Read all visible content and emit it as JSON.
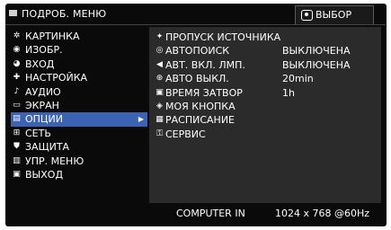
{
  "header": {
    "menu_title": "ПОДРОБ. МЕНЮ",
    "select_hint": "ВЫБОР"
  },
  "sidebar": {
    "items": [
      {
        "label": "КАРТИНКА",
        "icon": "picture-icon"
      },
      {
        "label": "ИЗОБР.",
        "icon": "image-icon"
      },
      {
        "label": "ВХОД",
        "icon": "input-icon"
      },
      {
        "label": "НАСТРОЙКА",
        "icon": "setup-icon"
      },
      {
        "label": "АУДИО",
        "icon": "audio-icon"
      },
      {
        "label": "ЭКРАН",
        "icon": "screen-icon"
      },
      {
        "label": "ОПЦИИ",
        "icon": "options-icon",
        "active": true
      },
      {
        "label": "СЕТЬ",
        "icon": "network-icon"
      },
      {
        "label": "ЗАЩИТА",
        "icon": "shield-icon"
      },
      {
        "label": "УПР. МЕНЮ",
        "icon": "menu-control-icon"
      },
      {
        "label": "ВЫХОД",
        "icon": "exit-icon"
      }
    ]
  },
  "options": {
    "rows": [
      {
        "label": "ПРОПУСК ИСТОЧНИКА",
        "value": "",
        "icon": "skip-source-icon"
      },
      {
        "label": "АВТОПОИСК",
        "value": "ВЫКЛЮЧЕНА",
        "icon": "auto-search-icon"
      },
      {
        "label": "АВТ. ВКЛ. ЛМП.",
        "value": "ВЫКЛЮЧЕНА",
        "icon": "auto-lamp-icon"
      },
      {
        "label": "АВТО ВЫКЛ.",
        "value": "20min",
        "icon": "auto-off-icon"
      },
      {
        "label": "ВРЕМЯ ЗАТВОР",
        "value": "1h",
        "icon": "shutter-timer-icon"
      },
      {
        "label": "МОЯ КНОПКА",
        "value": "",
        "icon": "my-button-icon"
      },
      {
        "label": "РАСПИСАНИЕ",
        "value": "",
        "icon": "schedule-icon"
      },
      {
        "label": "СЕРВИС",
        "value": "",
        "icon": "service-icon"
      }
    ]
  },
  "footer": {
    "source": "COMPUTER IN",
    "resolution": "1024 x 768 @60Hz"
  }
}
